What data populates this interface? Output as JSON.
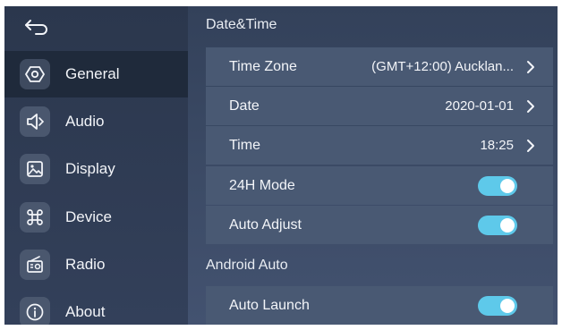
{
  "sidebar": {
    "back_icon": "back-arrow-icon",
    "items": [
      {
        "label": "General",
        "icon": "general-settings-icon",
        "active": true
      },
      {
        "label": "Audio",
        "icon": "speaker-icon",
        "active": false
      },
      {
        "label": "Display",
        "icon": "image-icon",
        "active": false
      },
      {
        "label": "Device",
        "icon": "command-key-icon",
        "active": false
      },
      {
        "label": "Radio",
        "icon": "radio-icon",
        "active": false
      },
      {
        "label": "About",
        "icon": "info-icon",
        "active": false
      }
    ]
  },
  "main": {
    "datetime_title": "Date&Time",
    "timezone": {
      "label": "Time Zone",
      "value": "(GMT+12:00) Aucklan..."
    },
    "date": {
      "label": "Date",
      "value": "2020-01-01"
    },
    "time": {
      "label": "Time",
      "value": "18:25"
    },
    "mode24": {
      "label": "24H Mode",
      "on": true
    },
    "auto_adjust": {
      "label": "Auto Adjust",
      "on": true
    },
    "android_title": "Android Auto",
    "auto_launch": {
      "label": "Auto Launch",
      "on": true
    }
  },
  "colors": {
    "toggle_on": "#5ec9ea",
    "row_bg": "#495973",
    "sidebar_active": "#1f2a3b"
  }
}
